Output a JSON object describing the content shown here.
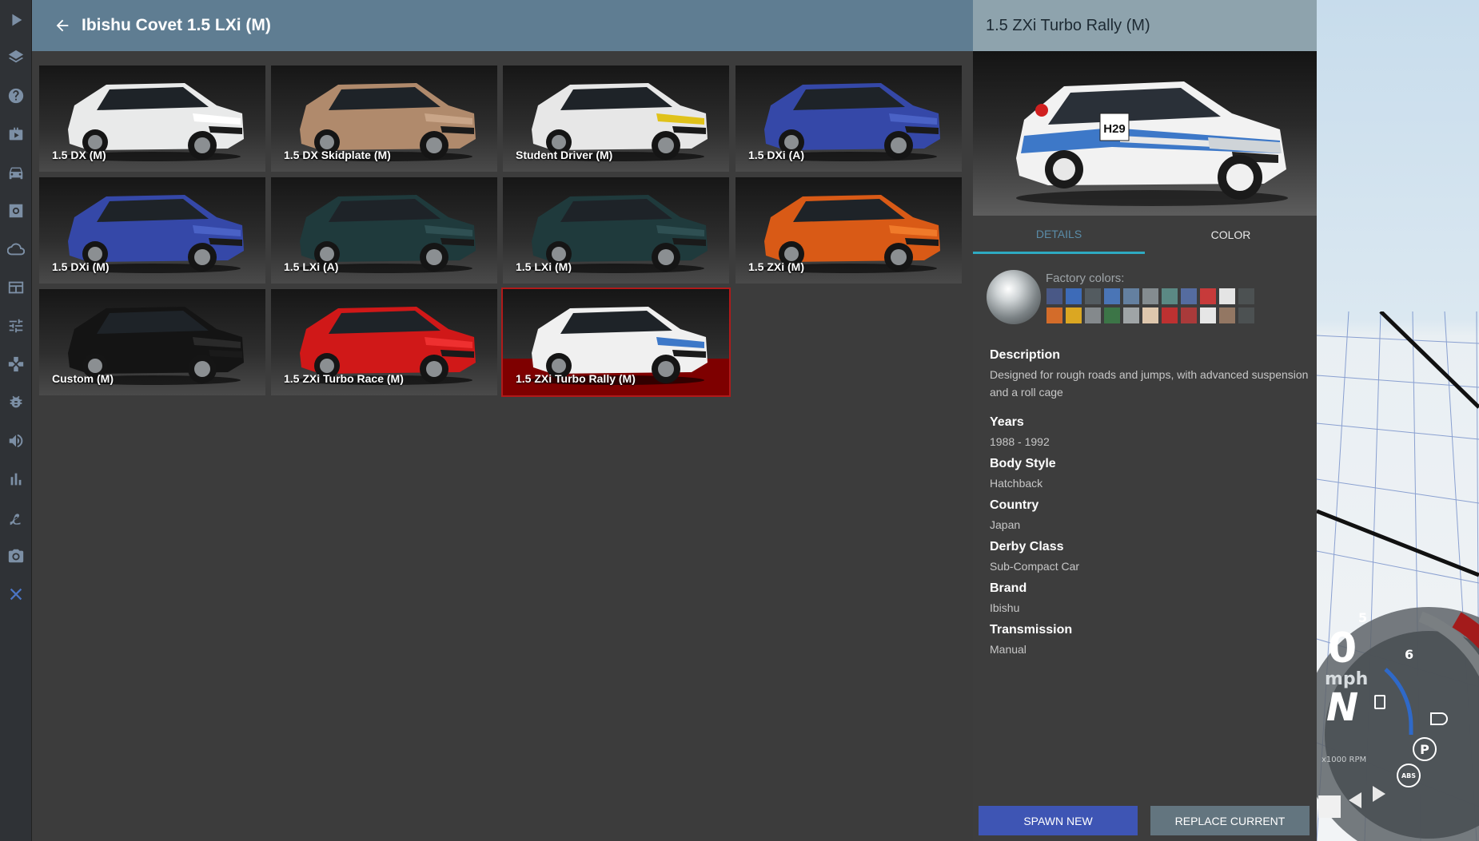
{
  "list": {
    "title": "Ibishu Covet 1.5 LXi (M)",
    "vehicles": [
      {
        "label": "1.5 DX (M)",
        "body": "#e9eaea",
        "accent": "#ffffff"
      },
      {
        "label": "1.5 DX Skidplate (M)",
        "body": "#b08a6c",
        "accent": "#c9a588"
      },
      {
        "label": "Student Driver (M)",
        "body": "#e7e7e7",
        "accent": "#e0c21a"
      },
      {
        "label": "1.5 DXi (A)",
        "body": "#3548a8",
        "accent": "#4a62c6"
      },
      {
        "label": "1.5 DXi (M)",
        "body": "#3548a8",
        "accent": "#4a62c6"
      },
      {
        "label": "1.5 LXi (A)",
        "body": "#1f3a3c",
        "accent": "#2f5053"
      },
      {
        "label": "1.5 LXi (M)",
        "body": "#1f3a3c",
        "accent": "#2f5053"
      },
      {
        "label": "1.5 ZXi (M)",
        "body": "#d95a16",
        "accent": "#f07a2a"
      },
      {
        "label": "Custom (M)",
        "body": "#141414",
        "accent": "#2a2a2a"
      },
      {
        "label": "1.5 ZXi Turbo Race (M)",
        "body": "#d01818",
        "accent": "#ee3030"
      },
      {
        "label": "1.5 ZXi Turbo Rally (M)",
        "body": "#f0f0f0",
        "accent": "#3d78c8"
      }
    ],
    "selected_index": 10
  },
  "detail": {
    "title": "1.5 ZXi Turbo Rally (M)",
    "preview_plate": "H29",
    "tabs": {
      "details": "DETAILS",
      "color": "COLOR"
    },
    "factory_colors_label": "Factory colors:",
    "factory_colors": [
      "#4a5a8c",
      "#3d6fc2",
      "#555d63",
      "#4b79c0",
      "#6786a8",
      "#8a9397",
      "#5d8f8a",
      "#5770a8",
      "#d23a3a",
      "#f2f2f2",
      "#4d5254",
      "#e07028",
      "#e8b020",
      "#8a8f92",
      "#3c7a48",
      "#a7adaf",
      "#ecd2b6",
      "#c83030",
      "#b23a3a",
      "#f4f4f4",
      "#9a7c66",
      "#4d5254"
    ],
    "info": [
      {
        "key": "Description",
        "value": "Designed for rough roads and jumps, with advanced suspension and a roll cage"
      },
      {
        "key": "Years",
        "value": "1988 - 1992"
      },
      {
        "key": "Body Style",
        "value": "Hatchback"
      },
      {
        "key": "Country",
        "value": "Japan"
      },
      {
        "key": "Derby Class",
        "value": "Sub-Compact Car"
      },
      {
        "key": "Brand",
        "value": "Ibishu"
      },
      {
        "key": "Transmission",
        "value": "Manual"
      }
    ],
    "buttons": {
      "spawn": "SPAWN NEW",
      "replace": "REPLACE CURRENT"
    }
  },
  "hud": {
    "speed": "0",
    "speed_unit": "mph",
    "gear": "N",
    "rpm_label": "x1000 RPM",
    "tick_5": "5",
    "tick_6": "6",
    "park_label": "P",
    "abs_label": "ABS"
  },
  "rail_icons": [
    "play-icon",
    "layers-icon",
    "help-icon",
    "scenario-icon",
    "vehicle-icon",
    "vehicle-config-icon",
    "environment-icon",
    "app-manager-icon",
    "options-icon",
    "controls-icon",
    "debug-icon",
    "audio-icon",
    "performance-icon",
    "track-builder-icon",
    "camera-icon",
    "close-icon"
  ]
}
